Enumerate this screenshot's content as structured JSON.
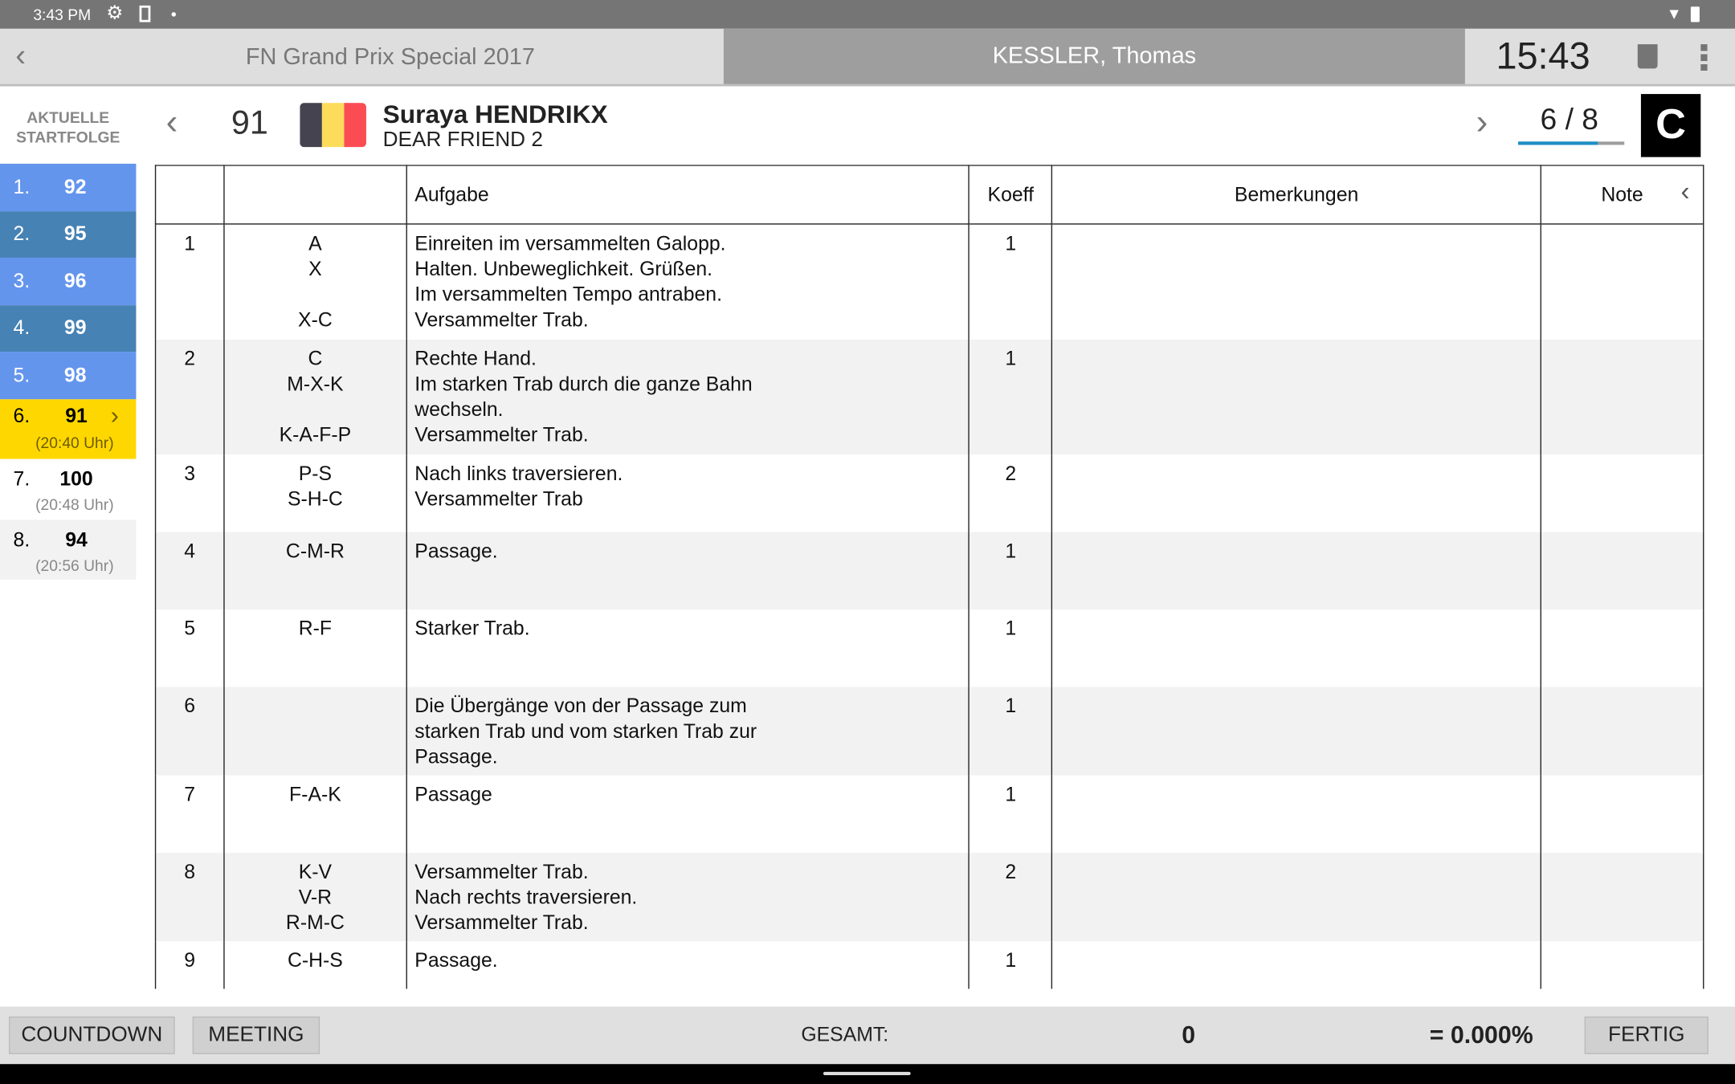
{
  "status_bar": {
    "time": "3:43 PM"
  },
  "header": {
    "event_title": "FN Grand Prix Special 2017",
    "judge": "KESSLER, Thomas",
    "clock": "15:43"
  },
  "rider": {
    "start_number": "91",
    "name": "Suraya HENDRIKX",
    "horse": "DEAR FRIEND 2",
    "flag_colors": [
      "#45434f",
      "#fddc5c",
      "#fb4c54"
    ],
    "position": "6 / 8",
    "progress": 0.75,
    "judge_position": "C"
  },
  "sidebar": {
    "title_line1": "AKTUELLE",
    "title_line2": "STARTFOLGE",
    "items": [
      {
        "rank": "1.",
        "number": "92",
        "state": "done"
      },
      {
        "rank": "2.",
        "number": "95",
        "state": "done"
      },
      {
        "rank": "3.",
        "number": "96",
        "state": "done"
      },
      {
        "rank": "4.",
        "number": "99",
        "state": "done"
      },
      {
        "rank": "5.",
        "number": "98",
        "state": "done"
      },
      {
        "rank": "6.",
        "number": "91",
        "time": "(20:40 Uhr)",
        "state": "current"
      },
      {
        "rank": "7.",
        "number": "100",
        "time": "(20:48 Uhr)",
        "state": "upcoming"
      },
      {
        "rank": "8.",
        "number": "94",
        "time": "(20:56 Uhr)",
        "state": "upcoming"
      }
    ]
  },
  "table": {
    "headers": {
      "nr": "",
      "points": "",
      "task": "Aufgabe",
      "coeff": "Koeff",
      "remarks": "Bemerkungen",
      "score": "Note"
    },
    "rows": [
      {
        "nr": "1",
        "points": "A\nX\n\nX-C",
        "task": "Einreiten im versammelten Galopp.\nHalten. Unbeweglichkeit. Grüßen.\nIm versammelten Tempo antraben.\nVersammelter Trab.",
        "coeff": "1"
      },
      {
        "nr": "2",
        "points": "C\nM-X-K\n\nK-A-F-P",
        "task": "Rechte Hand.\nIm starken Trab durch die ganze Bahn\nwechseln.\nVersammelter Trab.",
        "coeff": "1"
      },
      {
        "nr": "3",
        "points": "P-S\nS-H-C",
        "task": "Nach links traversieren.\nVersammelter Trab",
        "coeff": "2"
      },
      {
        "nr": "4",
        "points": "C-M-R",
        "task": "Passage.",
        "coeff": "1"
      },
      {
        "nr": "5",
        "points": "R-F",
        "task": "Starker Trab.",
        "coeff": "1"
      },
      {
        "nr": "6",
        "points": "",
        "task": "Die Übergänge von der Passage zum\nstarken Trab und vom starken Trab zur\nPassage.",
        "coeff": "1"
      },
      {
        "nr": "7",
        "points": "F-A-K",
        "task": "Passage",
        "coeff": "1"
      },
      {
        "nr": "8",
        "points": "K-V\nV-R\nR-M-C",
        "task": "Versammelter Trab.\nNach rechts traversieren.\nVersammelter Trab.",
        "coeff": "2"
      },
      {
        "nr": "9",
        "points": "C-H-S",
        "task": "Passage.",
        "coeff": "1"
      }
    ]
  },
  "footer": {
    "countdown": "COUNTDOWN",
    "meeting": "MEETING",
    "total_label": "GESAMT:",
    "total": "0",
    "percent": "= 0.000%",
    "done": "FERTIG"
  }
}
